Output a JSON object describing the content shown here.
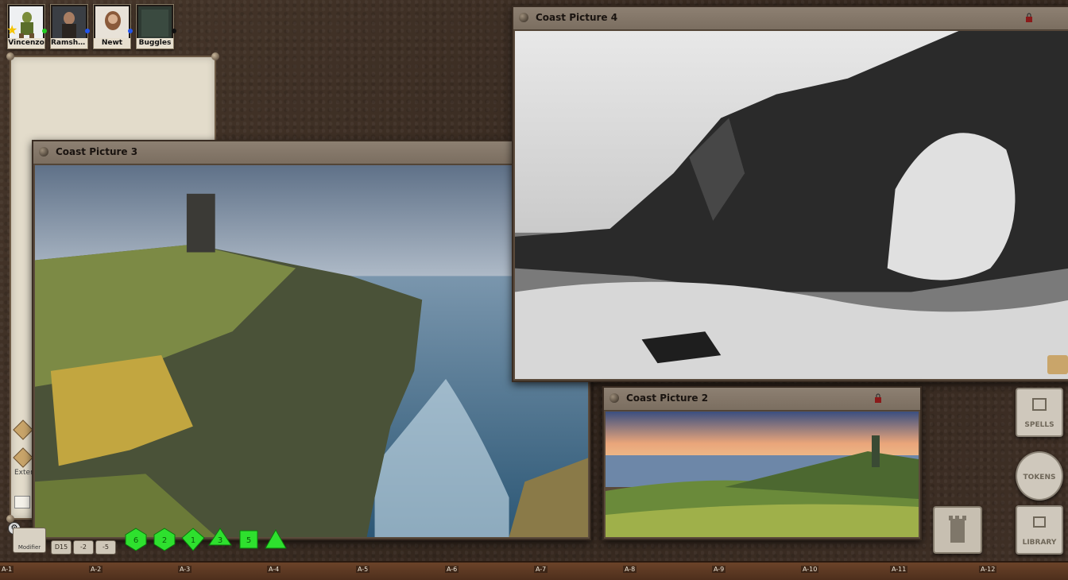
{
  "portraits": [
    {
      "name": "Vincenzo",
      "status_color": "#22cc22",
      "active": true
    },
    {
      "name": "Ramsham...",
      "status_color": "#2255ee",
      "active": false
    },
    {
      "name": "Newt",
      "status_color": "#2255ee",
      "active": false
    },
    {
      "name": "Buggles",
      "status_color": "#111111",
      "active": false
    }
  ],
  "windows": {
    "pic3": {
      "title": "Coast Picture 3"
    },
    "pic4": {
      "title": "Coast Picture 4"
    },
    "pic2": {
      "title": "Coast Picture 2"
    }
  },
  "sidebar_partial_label": "Exter",
  "modifier_label": "Modifier",
  "modifier_buttons": [
    "D15",
    "-2",
    "-5"
  ],
  "dice": [
    "d4",
    "d6",
    "d8",
    "d10",
    "d12",
    "d20"
  ],
  "dice_faces": [
    "6",
    "2",
    "1",
    "3",
    "5",
    ""
  ],
  "right_toolbar": [
    {
      "label": "SPELLS"
    },
    {
      "label": "TOKENS"
    },
    {
      "label": "LIBRARY"
    }
  ],
  "ruler": [
    "A-1",
    "A-2",
    "A-3",
    "A-4",
    "A-5",
    "A-6",
    "A-7",
    "A-8",
    "A-9",
    "A-10",
    "A-11",
    "A-12"
  ],
  "colors": {
    "accent_green": "#2ee02e",
    "parchment": "#e3dccb",
    "leather": "#3e2f24"
  }
}
